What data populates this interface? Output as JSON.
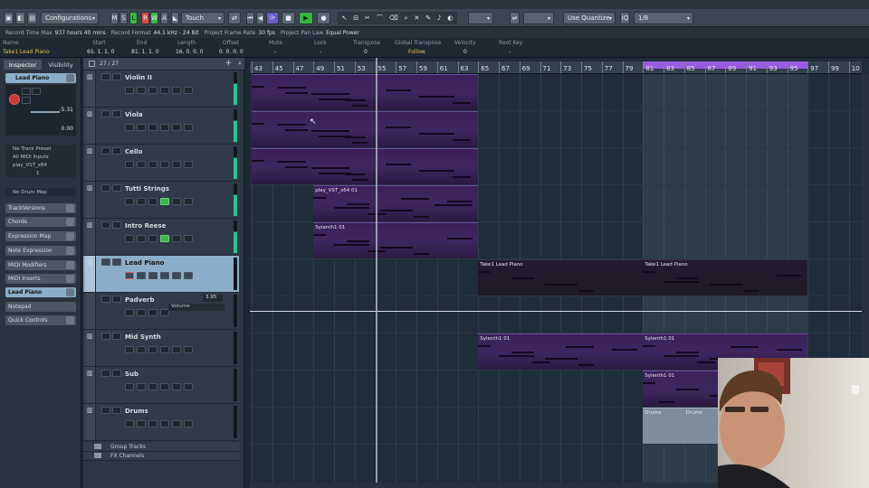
{
  "toolbar": {
    "configurations_label": "Configurations",
    "mode_buttons": [
      "M",
      "S",
      "L",
      "R",
      "W",
      "A"
    ],
    "automation_mode": "Touch",
    "quantize_label": "Use Quantize",
    "quantize_value": "1/8"
  },
  "info_line": {
    "items": [
      {
        "label": "Record Time Max",
        "value": "937 hours 40 mins"
      },
      {
        "label": "Record Format",
        "value": "44.1 kHz - 24 Bit"
      },
      {
        "label": "Project Frame Rate",
        "value": "30 fps"
      },
      {
        "label": "Project Pan Law",
        "value": "Equal Power"
      }
    ]
  },
  "event_line": {
    "labels": [
      "Name",
      "Start",
      "End",
      "Length",
      "Offset",
      "Mute",
      "Lock",
      "Transpose",
      "Global Transpose",
      "Velocity",
      "Root Key"
    ],
    "values": [
      "Take1 Lead Piano",
      "65. 1. 1. 0",
      "81. 1. 1. 0",
      "16. 0. 0. 0",
      "0. 0. 0. 0",
      "-",
      "-",
      "0",
      "Follow",
      "0",
      "-"
    ]
  },
  "inspector": {
    "tab_inspector": "Inspector",
    "tab_visibility": "Visibility",
    "track_name": "Lead Piano",
    "volume_value": "-5.31",
    "pan_value": "0.00",
    "track_preset": "No Track Preset",
    "midi_input": "All MIDI Inputs",
    "midi_output": "play_VST_x64",
    "channel": "1",
    "drum_map": "No Drum Map",
    "sections": [
      "TrackVersions",
      "Chords",
      "Expression Map",
      "Note Expression",
      "MIDI Modifiers",
      "MIDI Inserts",
      "Lead Piano",
      "Notepad",
      "Quick Controls"
    ]
  },
  "tracklist": {
    "counter": "27 / 27",
    "tracks": [
      {
        "name": "Violin II"
      },
      {
        "name": "Viola"
      },
      {
        "name": "Cello"
      },
      {
        "name": "Tutti Strings"
      },
      {
        "name": "Intro Reese"
      },
      {
        "name": "Lead Piano"
      },
      {
        "name": "Padverb",
        "automation": "Volume",
        "value": "3.95"
      },
      {
        "name": "Mid Synth"
      },
      {
        "name": "Sub"
      },
      {
        "name": "Drums"
      }
    ],
    "folders": [
      "Group Tracks",
      "FX Channels"
    ]
  },
  "ruler": {
    "bars": [
      "43",
      "45",
      "47",
      "49",
      "51",
      "53",
      "55",
      "57",
      "59",
      "61",
      "63",
      "65",
      "67",
      "69",
      "71",
      "73",
      "75",
      "77",
      "79",
      "81",
      "83",
      "85",
      "87",
      "89",
      "91",
      "93",
      "95",
      "97",
      "99",
      "10"
    ]
  },
  "parts": {
    "tutti": "play_VST_x64 01",
    "reese": "Sylenth1 01",
    "piano_a": "Take1 Lead Piano",
    "piano_b": "Take1 Lead Piano",
    "mid_a": "Sylenth1 01",
    "mid_b": "Sylenth1 01",
    "sub": "Sylenth1 01",
    "drums_a": "Drums",
    "drums_b": "Drums"
  },
  "colors": {
    "accent_purple": "#9b5be0",
    "part_purple": "#3f2660",
    "record_red": "#c43a3a",
    "play_green": "#36b341",
    "selected_track": "#8cadc8"
  }
}
